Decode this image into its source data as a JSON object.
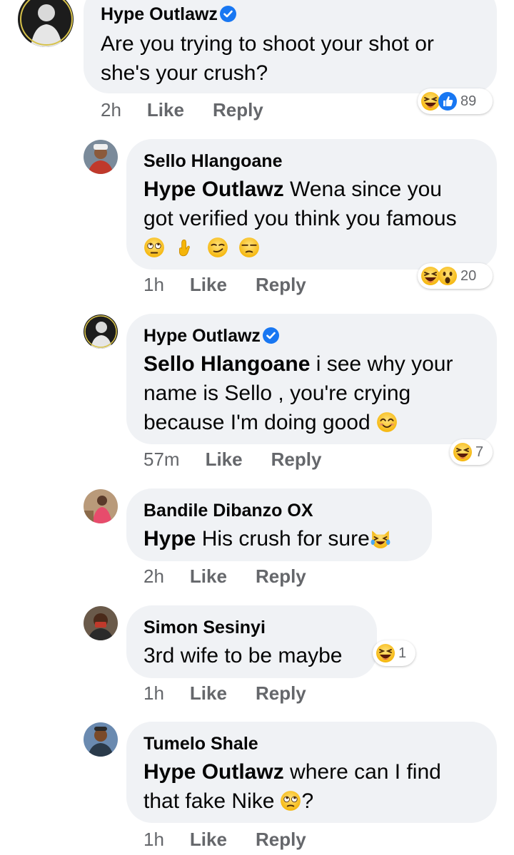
{
  "comments": [
    {
      "author": "Hype Outlawz",
      "verified": true,
      "lines": [
        "Are you trying to shoot your shot or",
        "she's your crush?"
      ],
      "time": "2h",
      "like": "Like",
      "reply": "Reply",
      "reactions": {
        "icons": [
          "laugh-emoji",
          "like-thumb"
        ],
        "count": "89"
      }
    },
    {
      "author": "Sello Hlangoane",
      "mention": "Hype Outlawz",
      "lines": [
        "Wena since you",
        "got verified you think you famous"
      ],
      "emojis": [
        "eye-roll-emoji",
        "crossed-fingers-emoji",
        "smirk-emoji",
        "unamused-emoji"
      ],
      "time": "1h",
      "like": "Like",
      "reply": "Reply",
      "reactions": {
        "icons": [
          "laugh-emoji",
          "wow-emoji"
        ],
        "count": "20"
      }
    },
    {
      "author": "Hype Outlawz",
      "verified": true,
      "mention": "Sello Hlangoane",
      "lines": [
        "i see why your",
        "name is Sello , you're crying",
        "because I'm doing good"
      ],
      "time": "57m",
      "like": "Like",
      "reply": "Reply",
      "reactions": {
        "icons": [
          "laugh-emoji"
        ],
        "count": "7"
      }
    },
    {
      "author": "Bandile Dibanzo OX",
      "mention": "Hype",
      "lines": [
        "His crush for sure"
      ],
      "time": "2h",
      "like": "Like",
      "reply": "Reply"
    },
    {
      "author": "Simon Sesinyi",
      "lines": [
        "3rd wife to be maybe"
      ],
      "time": "1h",
      "like": "Like",
      "reply": "Reply",
      "reactions": {
        "icons": [
          "laugh-emoji"
        ],
        "count": "1"
      }
    },
    {
      "author": "Tumelo Shale",
      "mention": "Hype Outlawz",
      "lines": [
        "where  can I find",
        "that fake Nike",
        "?"
      ],
      "time": "1h",
      "like": "Like",
      "reply": "Reply"
    }
  ],
  "colors": {
    "bubble": "#f0f2f5",
    "meta": "#65676b",
    "verified": "#1877f2",
    "like": "#1877f2",
    "emoji": "#f7c531"
  }
}
